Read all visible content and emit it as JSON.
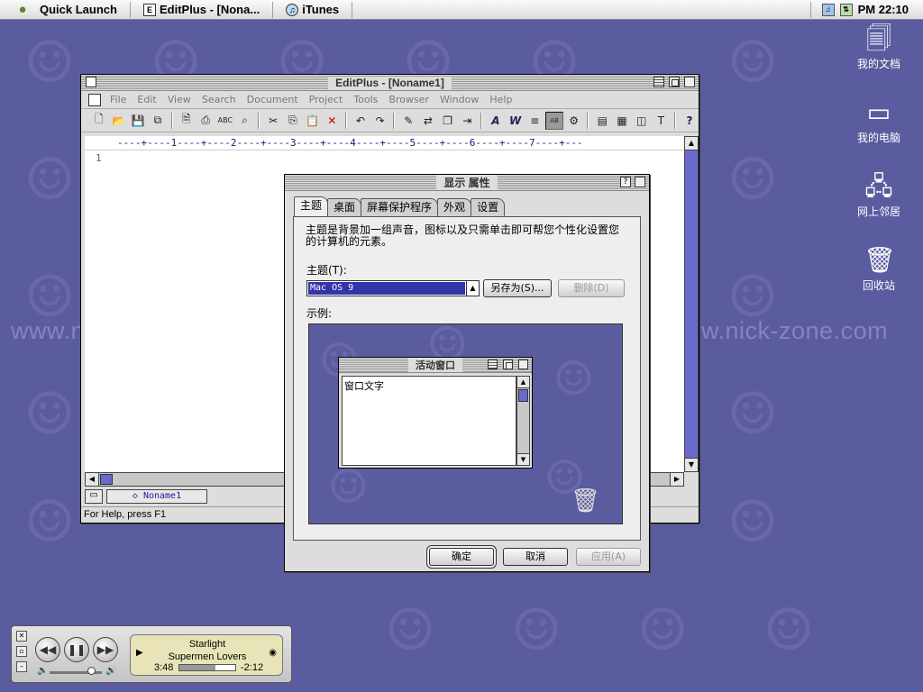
{
  "menubar": {
    "quick_launch": "Quick Launch",
    "editplus_task": "EditPlus - [Nona...",
    "itunes_task": "iTunes",
    "clock": "PM 22:10"
  },
  "desktop": {
    "watermark": "www.nick-zone.com",
    "icons": [
      {
        "label": "我的文档",
        "icon": "documents-icon"
      },
      {
        "label": "我的电脑",
        "icon": "computer-icon"
      },
      {
        "label": "网上邻居",
        "icon": "network-icon"
      },
      {
        "label": "回收站",
        "icon": "trash-icon"
      }
    ]
  },
  "editplus": {
    "title": "EditPlus - [Noname1]",
    "menu": [
      "File",
      "Edit",
      "View",
      "Search",
      "Document",
      "Project",
      "Tools",
      "Browser",
      "Window",
      "Help"
    ],
    "ruler": "----+----1----+----2----+----3----+----4----+----5----+----6----+----7----+---",
    "line_number": "1",
    "doc_tab": "◇ Noname1",
    "status": "For Help, press F1"
  },
  "display_properties": {
    "title": "显示 属性",
    "tabs": [
      "主题",
      "桌面",
      "屏幕保护程序",
      "外观",
      "设置"
    ],
    "selected_tab": "主题",
    "description": "主题是背景加一组声音，图标以及只需单击即可帮您个性化设置您的计算机的元素。",
    "theme_label": "主题(T):",
    "theme_value": "Mac OS 9",
    "save_as_button": "另存为(S)...",
    "delete_button": "删除(D)",
    "sample_label": "示例:",
    "preview": {
      "window_title": "活动窗口",
      "window_text": "窗口文字"
    },
    "ok_button": "确定",
    "cancel_button": "取消",
    "apply_button": "应用(A)"
  },
  "itunes": {
    "song": "Starlight",
    "artist": "Supermen Lovers",
    "elapsed": "3:48",
    "remaining": "-2:12",
    "progress": 0.64,
    "volume": 0.8
  },
  "colors": {
    "desktop": "#5b5b9f",
    "selection": "#3333aa",
    "scroll_accent": "#6a6acc"
  }
}
